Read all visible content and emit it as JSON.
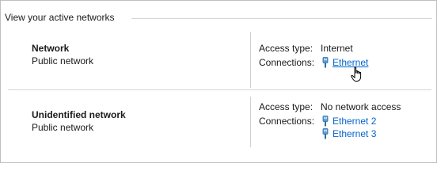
{
  "section": {
    "title": "View your active networks"
  },
  "networks": [
    {
      "name": "Network",
      "category": "Public network",
      "access_label": "Access type:",
      "access_value": "Internet",
      "connections_label": "Connections:",
      "connections": [
        "Ethernet"
      ]
    },
    {
      "name": "Unidentified network",
      "category": "Public network",
      "access_label": "Access type:",
      "access_value": "No network access",
      "connections_label": "Connections:",
      "connections": [
        "Ethernet 2",
        "Ethernet 3"
      ]
    }
  ],
  "colors": {
    "link": "#0066cc",
    "divider": "#d4d4d4",
    "icon": "#5b9bd5"
  },
  "icons": {
    "connection": "ethernet-icon",
    "pointer": "hand-pointer-icon"
  }
}
